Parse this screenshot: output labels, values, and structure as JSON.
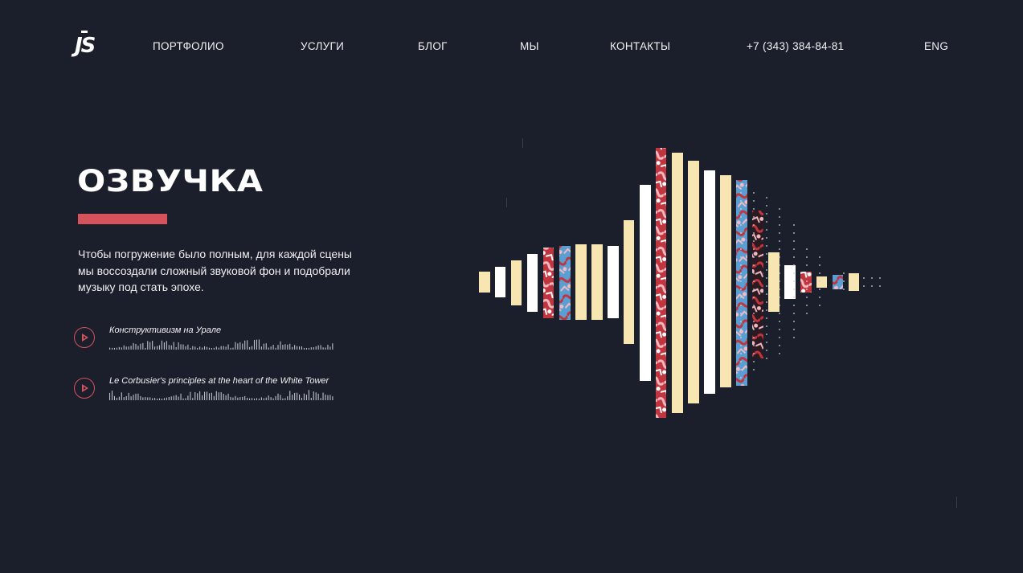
{
  "logo": {
    "text": "JS"
  },
  "nav": {
    "items": [
      {
        "label": "ПОРТФОЛИО"
      },
      {
        "label": "УСЛУГИ"
      },
      {
        "label": "БЛОГ"
      },
      {
        "label": "МЫ"
      },
      {
        "label": "КОНТАКТЫ"
      }
    ],
    "phone": "+7 (343) 384-84-81",
    "lang": "ENG"
  },
  "hero": {
    "title": "ОЗВУЧКА",
    "description": "Чтобы погружение было полным, для каждой сцены мы воссоздали сложный звуковой фон и подобрали музыку под стать эпохе."
  },
  "tracks": [
    {
      "title": "Конструктивизм на Урале",
      "play_icon": "play-icon"
    },
    {
      "title": "Le Corbusier's principles at the heart of the White Tower",
      "play_icon": "play-icon"
    }
  ],
  "colors": {
    "background": "#1b1e2b",
    "accent": "#d6525c",
    "cream": "#f7e6b2",
    "white": "#ffffff",
    "pattern_red": "#c1353f",
    "pattern_pink": "#f1b9c1",
    "pattern_blue": "#5a9fd4",
    "pattern_dark": "#2b1a22"
  }
}
